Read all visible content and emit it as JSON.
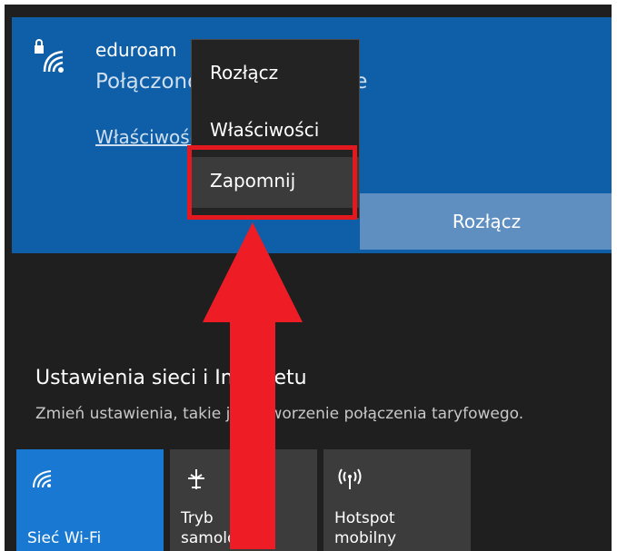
{
  "network": {
    "name": "eduroam",
    "status": "Połączono, zabezpieczone",
    "properties_link": "Właściwości",
    "disconnect_button": "Rozłącz"
  },
  "context_menu": {
    "items": [
      {
        "label": "Rozłącz"
      },
      {
        "label": "Właściwości"
      },
      {
        "label": "Zapomnij"
      }
    ],
    "highlighted_item": "Zapomnij"
  },
  "settings": {
    "title": "Ustawienia sieci i Internetu",
    "subtitle": "Zmień ustawienia, takie jak utworzenie połączenia taryfowego."
  },
  "tiles": [
    {
      "label": "Sieć Wi-Fi",
      "icon": "wifi-icon",
      "active": true
    },
    {
      "label_lines": [
        "Tryb",
        "samolotowy"
      ],
      "icon": "airplane-icon",
      "active": false
    },
    {
      "label_lines": [
        "Hotspot",
        "mobilny"
      ],
      "icon": "hotspot-icon",
      "active": false
    }
  ],
  "colors": {
    "accent_blue": "#0f5ea8",
    "tile_active": "#1979d2",
    "highlight_red": "#e4181f",
    "arrow_red": "#ee1c25"
  }
}
